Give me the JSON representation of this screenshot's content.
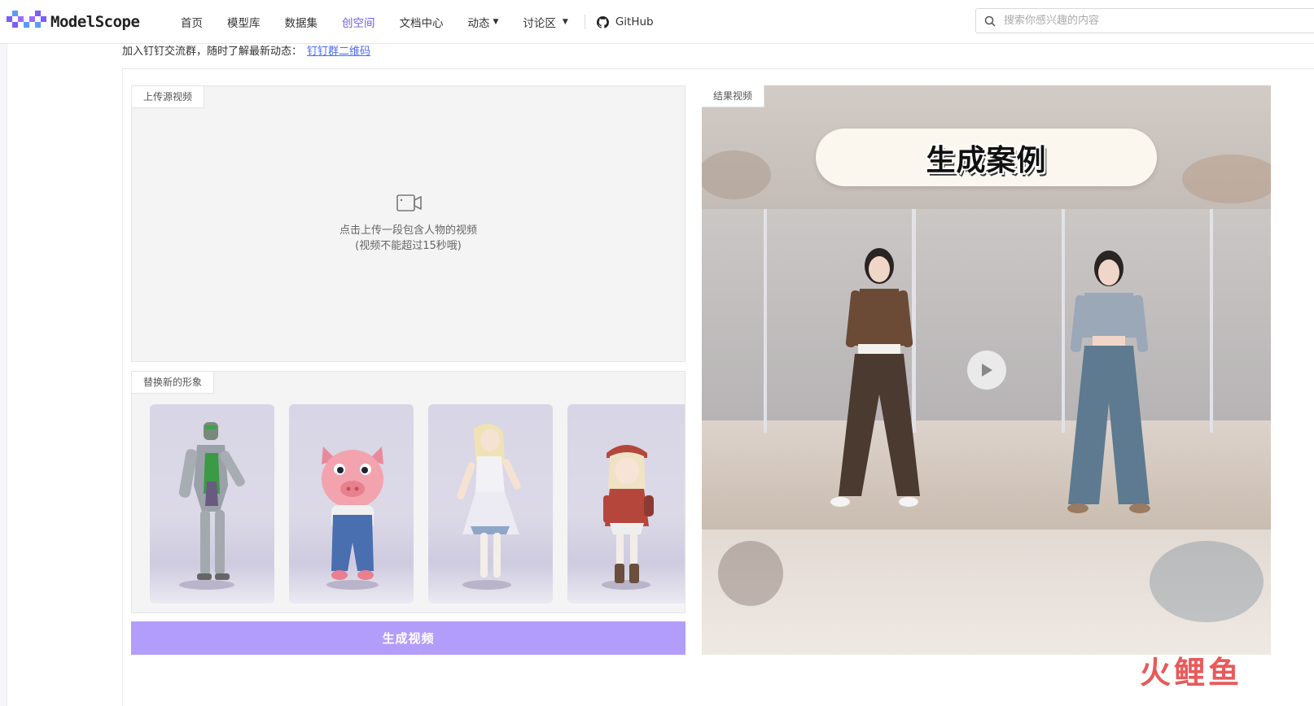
{
  "header": {
    "logo_text": "ModelScope",
    "nav": [
      {
        "label": "首页"
      },
      {
        "label": "模型库"
      },
      {
        "label": "数据集"
      },
      {
        "label": "创空间"
      },
      {
        "label": "文档中心"
      },
      {
        "label": "动态"
      },
      {
        "label": "讨论区"
      }
    ],
    "github_label": "GitHub",
    "search_placeholder": "搜索你感兴趣的内容"
  },
  "info": {
    "text": "加入钉钉交流群，随时了解最新动态：",
    "link": "钉钉群二维码"
  },
  "upload": {
    "tag": "上传源视频",
    "hint_line1": "点击上传一段包含人物的视频",
    "hint_line2": "(视频不能超过15秒哦)"
  },
  "characters": {
    "tag": "替换新的形象"
  },
  "generate_button": "生成视频",
  "result": {
    "tag": "结果视频",
    "banner": "生成案例"
  },
  "watermark": "火鲤鱼",
  "colors": {
    "accent": "#6c5ce7",
    "button": "#b39dfa",
    "link": "#4a6cf7"
  }
}
